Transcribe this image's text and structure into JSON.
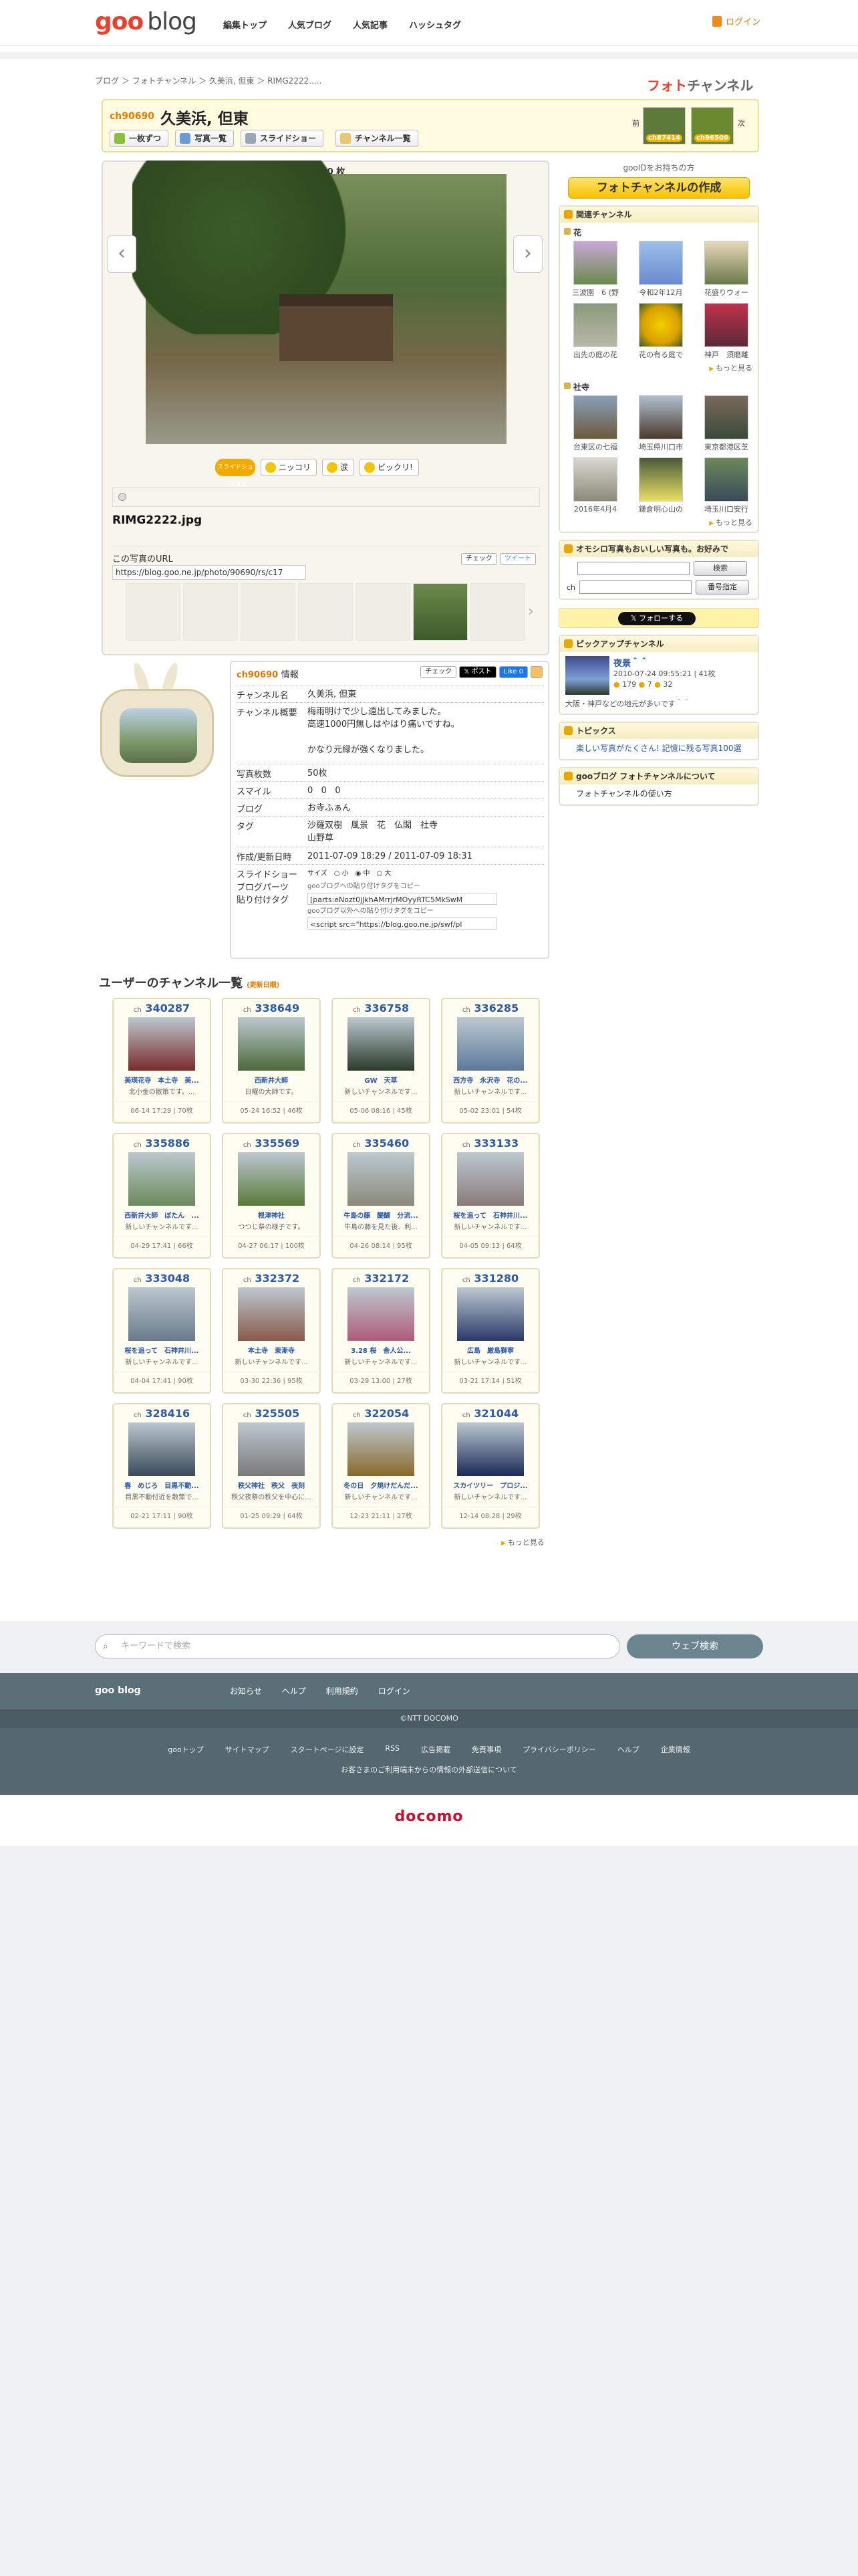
{
  "header": {
    "logo_goo": "goo",
    "logo_blog": "blog",
    "nav": [
      "編集トップ",
      "人気ブログ",
      "人気記事",
      "ハッシュタグ"
    ],
    "login": "ログイン"
  },
  "breadcrumb": "ブログ ＞ フォトチャンネル ＞ 久美浜, 但東 ＞ RIMG2222.....",
  "brand_right": {
    "a": "フォト",
    "b": "チャンネル"
  },
  "channel": {
    "no": "ch90690",
    "title": "久美浜, 但東",
    "buttons": [
      "一枚ずつ",
      "写真一覧",
      "スライドショー",
      "チャンネル一覧"
    ],
    "prev": "前",
    "next": "次",
    "prev_no": "ch87414",
    "next_no": "ch96500"
  },
  "viewer": {
    "counter": "6 / 50 枚",
    "slide_tag": "スライドショーで見る",
    "reactions": [
      "ニッコリ",
      "涙",
      "ビックリ!"
    ],
    "filename": "RIMG2222.jpg",
    "url_label": "この写真のURL",
    "url": "https://blog.goo.ne.jp/photo/90690/rs/c17",
    "share": [
      "チェック",
      "ツイート"
    ]
  },
  "sidebar": {
    "gooid": "gooIDをお持ちの方",
    "create": "フォトチャンネルの作成",
    "related_title": "関連チャンネル",
    "group1_title": "花",
    "group1": [
      "三波園　6 (野",
      "令和2年12月",
      "花盛りウォー",
      "出先の庭の花",
      "花の有る庭で",
      "神戸　須磨離"
    ],
    "group2_title": "社寺",
    "group2": [
      "台東区の七福",
      "埼玉県川口市",
      "東京都港区芝",
      "2016年4月4",
      "鎌倉明心山の",
      "埼玉川口安行"
    ],
    "more": "もっと見る",
    "search_title": "オモシロ写真もおいしい写真も。お好みで",
    "search_btn": "検索",
    "ch_label": "ch",
    "num_btn": "番号指定",
    "follow": "フォローする",
    "pickup_title": "ピックアップチャンネル",
    "pickup": {
      "name": "夜景＾＾",
      "date": "2010-07-24 09:55:21",
      "count": "41枚",
      "desc": "大阪・神戸などの地元が多いです＾＾",
      "s1": "179",
      "s2": "7",
      "s3": "32"
    },
    "topics_title": "トピックス",
    "topic": "楽しい写真がたくさん! 記憶に残る写真100選",
    "about_title": "gooブログ フォトチャンネルについて",
    "about": "フォトチャンネルの使い方"
  },
  "info": {
    "no": "ch90690",
    "label": "情報",
    "rows": [
      {
        "k": "チャンネル名",
        "v": "久美浜, 但東"
      },
      {
        "k": "チャンネル概要",
        "v": "梅雨明けで少し遠出してみました。\n高速1000円無しはやはり痛いですね。\n\nかなり元緑が強くなりました。"
      },
      {
        "k": "写真枚数",
        "v": "50枚"
      },
      {
        "k": "スマイル",
        "v": "0   0   0"
      },
      {
        "k": "ブログ",
        "v": "お寺ふぁん"
      },
      {
        "k": "タグ",
        "v": "沙羅双樹　風景　花　仏閣　社寺\n山野草"
      },
      {
        "k": "作成/更新日時",
        "v": "2011-07-09 18:29 / 2011-07-09 18:31"
      }
    ],
    "slide_label": "スライドショー\nブログパーツ\n貼り付けタグ",
    "size_label": "サイズ",
    "sizes": [
      "小",
      "中",
      "大"
    ],
    "tag1_label": "gooブログへの貼り付けタグをコピー",
    "tag1": "[parts:eNozt0jJkhAMrrjrMOyyRTC5MkSwM",
    "tag2_label": "gooブログ以外への貼り付けタグをコピー",
    "tag2": "<script src=\"https://blog.goo.ne.jp/swf/pl"
  },
  "user_channels": {
    "title": "ユーザーのチャンネル一覧",
    "order": "(更新日順)",
    "cards": [
      {
        "no": "340287",
        "t": "美瑛花寺　本土寺　美...",
        "d": "北小金の散策です。...",
        "m": "06-14 17:29 | 70枚"
      },
      {
        "no": "338649",
        "t": "西新井大師",
        "d": "日曜の大師です。",
        "m": "05-24 16:52 | 46枚"
      },
      {
        "no": "336758",
        "t": "GW　天草",
        "d": "新しいチャンネルです...",
        "m": "05-06 08:16 | 45枚"
      },
      {
        "no": "336285",
        "t": "西方寺　永沢寺　花の...",
        "d": "新しいチャンネルです...",
        "m": "05-02 23:01 | 54枚"
      },
      {
        "no": "335886",
        "t": "西新井大師　ぼたん　...",
        "d": "新しいチャンネルです...",
        "m": "04-29 17:41 | 66枚"
      },
      {
        "no": "335569",
        "t": "根津神社",
        "d": "つつじ祭の様子です。",
        "m": "04-27 06:17 | 100枚"
      },
      {
        "no": "335460",
        "t": "牛島の藤　醍醐　分流...",
        "d": "牛島の藤を見た後、利...",
        "m": "04-26 08:14 | 95枚"
      },
      {
        "no": "333133",
        "t": "桜を追って　石神井川...",
        "d": "新しいチャンネルです...",
        "m": "04-05 09:13 | 64枚"
      },
      {
        "no": "333048",
        "t": "桜を追って　石神井川...",
        "d": "新しいチャンネルです...",
        "m": "04-04 17:41 | 90枚"
      },
      {
        "no": "332372",
        "t": "本土寺　東漸寺",
        "d": "新しいチャンネルです...",
        "m": "03-30 22:36 | 95枚"
      },
      {
        "no": "332172",
        "t": "3.28 桜　舎人公...",
        "d": "新しいチャンネルです...",
        "m": "03-29 13:00 | 27枚"
      },
      {
        "no": "331280",
        "t": "広島　厳島獅寧",
        "d": "新しいチャンネルです...",
        "m": "03-21 17:14 | 51枚"
      },
      {
        "no": "328416",
        "t": "春　めじろ　目黒不動...",
        "d": "目黒不動付近を散策で...",
        "m": "02-21 17:11 | 90枚"
      },
      {
        "no": "325505",
        "t": "秩父神社　秩父　夜刻",
        "d": "秩父夜祭の秩父を中心に...",
        "m": "01-25 09:29 | 64枚"
      },
      {
        "no": "322054",
        "t": "冬の日　夕焼けだんだ...",
        "d": "新しいチャンネルです...",
        "m": "12-23 21:11 | 27枚"
      },
      {
        "no": "321044",
        "t": "スカイツリー　プロジ...",
        "d": "新しいチャンネルです...",
        "m": "12-14 08:28 | 29枚"
      }
    ],
    "more": "もっと見る"
  },
  "footer": {
    "search_placeholder": "キーワードで検索",
    "search_btn": "ウェブ検索",
    "logo": "goo blog",
    "nav": [
      "お知らせ",
      "ヘルプ",
      "利用規約",
      "ログイン"
    ],
    "copyright": "©NTT DOCOMO",
    "links": [
      "gooトップ",
      "サイトマップ",
      "スタートページに設定",
      "RSS",
      "広告掲載",
      "免責事項",
      "プライバシーポリシー",
      "ヘルプ",
      "企業情報"
    ],
    "note": "お客さまのご利用端末からの情報の外部送信について",
    "docomo": "docomo"
  }
}
